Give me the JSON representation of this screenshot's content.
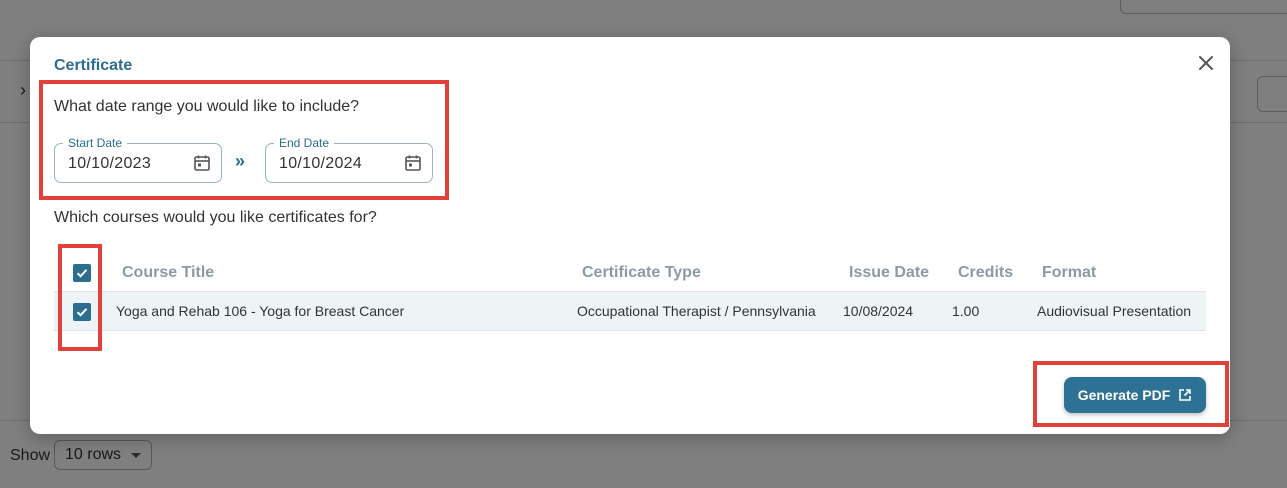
{
  "background": {
    "show_label": "Show",
    "rows_value": "10 rows"
  },
  "modal": {
    "title": "Certificate",
    "date_question": "What date range you would like to include?",
    "start_date": {
      "label": "Start Date",
      "value": "10/10/2023"
    },
    "end_date": {
      "label": "End Date",
      "value": "10/10/2024"
    },
    "range_separator": "»",
    "courses_question": "Which courses would you like certificates for?",
    "table": {
      "columns": [
        "Course Title",
        "Certificate Type",
        "Issue Date",
        "Credits",
        "Format"
      ],
      "rows": [
        {
          "checked": true,
          "course_title": "Yoga and Rehab 106 - Yoga for Breast Cancer",
          "certificate_type": "Occupational Therapist / Pennsylvania",
          "issue_date": "10/08/2024",
          "credits": "1.00",
          "format": "Audiovisual Presentation"
        }
      ]
    },
    "generate_button": "Generate PDF"
  },
  "icons": {
    "close": "close-icon",
    "calendar": "calendar-icon",
    "external": "external-link-icon",
    "check": "checkmark-icon"
  },
  "colors": {
    "accent": "#2b6e8f",
    "button": "#2d7294",
    "annotation": "#e2413a"
  }
}
